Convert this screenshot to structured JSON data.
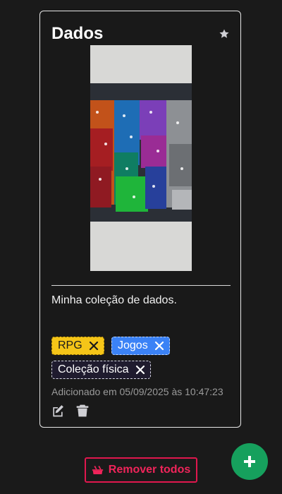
{
  "card": {
    "title": "Dados",
    "favorite_icon": "star-icon",
    "image_alt": "Dice collection photo",
    "description": "Minha coleção de dados.",
    "tags": [
      {
        "label": "RPG",
        "color": "#f5c518"
      },
      {
        "label": "Jogos",
        "color": "#3b82f6"
      },
      {
        "label": "Coleção física",
        "color": "#1f1b2e"
      }
    ],
    "added_text": "Adicionado em 05/09/2025 às 10:47:23",
    "actions": {
      "edit_icon": "edit-icon",
      "delete_icon": "trash-icon"
    }
  },
  "footer": {
    "remove_all_label": "Remover todos",
    "remove_all_icon": "broom-icon",
    "add_icon": "plus-icon"
  },
  "colors": {
    "background": "#1a1a1a",
    "danger": "#e0174e",
    "success": "#16a05d",
    "muted": "#9a9a9a"
  }
}
